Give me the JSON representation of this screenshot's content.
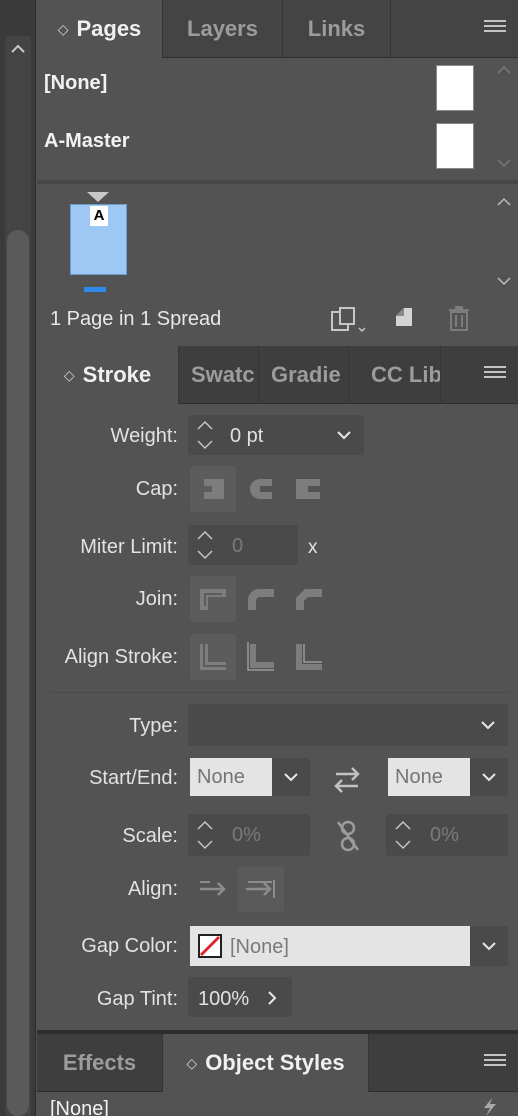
{
  "pages_panel": {
    "tabs": [
      {
        "label": "Pages",
        "active": true
      },
      {
        "label": "Layers",
        "active": false
      },
      {
        "label": "Links",
        "active": false
      }
    ],
    "masters": [
      "[None]",
      "A-Master"
    ],
    "page_master_letter": "A",
    "spread_info": "1 Page in 1 Spread"
  },
  "stroke_panel": {
    "tabs": [
      {
        "label": "Stroke",
        "active": true
      },
      {
        "label": "Swatc",
        "active": false
      },
      {
        "label": "Gradie",
        "active": false
      },
      {
        "label": "CC Lib",
        "active": false
      }
    ],
    "weight_label": "Weight:",
    "weight_value": "0 pt",
    "cap_label": "Cap:",
    "miter_label": "Miter Limit:",
    "miter_value": "0",
    "miter_suffix": "x",
    "join_label": "Join:",
    "align_stroke_label": "Align Stroke:",
    "type_label": "Type:",
    "type_value": "",
    "start_end_label": "Start/End:",
    "start_value": "None",
    "end_value": "None",
    "scale_label": "Scale:",
    "scale_start": "0%",
    "scale_end": "0%",
    "align_label": "Align:",
    "gap_color_label": "Gap Color:",
    "gap_color_value": "[None]",
    "gap_tint_label": "Gap Tint:",
    "gap_tint_value": "100%"
  },
  "effects_panel": {
    "tabs": [
      {
        "label": "Effects",
        "active": false
      },
      {
        "label": "Object Styles",
        "active": true
      }
    ],
    "first_item": "[None]"
  },
  "colors": {
    "panel_bg": "#535353",
    "tab_bar_bg": "#444444",
    "page_thumb": "#9ec8f4",
    "page_number_bar": "#2d8ceb",
    "none_swatch_slash": "#e0252a"
  },
  "icons": [
    "chevron-up-icon",
    "chevron-down-icon",
    "panel-menu-icon",
    "new-page-size-icon",
    "new-page-icon",
    "trash-icon",
    "swap-icon",
    "unlink-scale-icon",
    "lightning-icon"
  ]
}
